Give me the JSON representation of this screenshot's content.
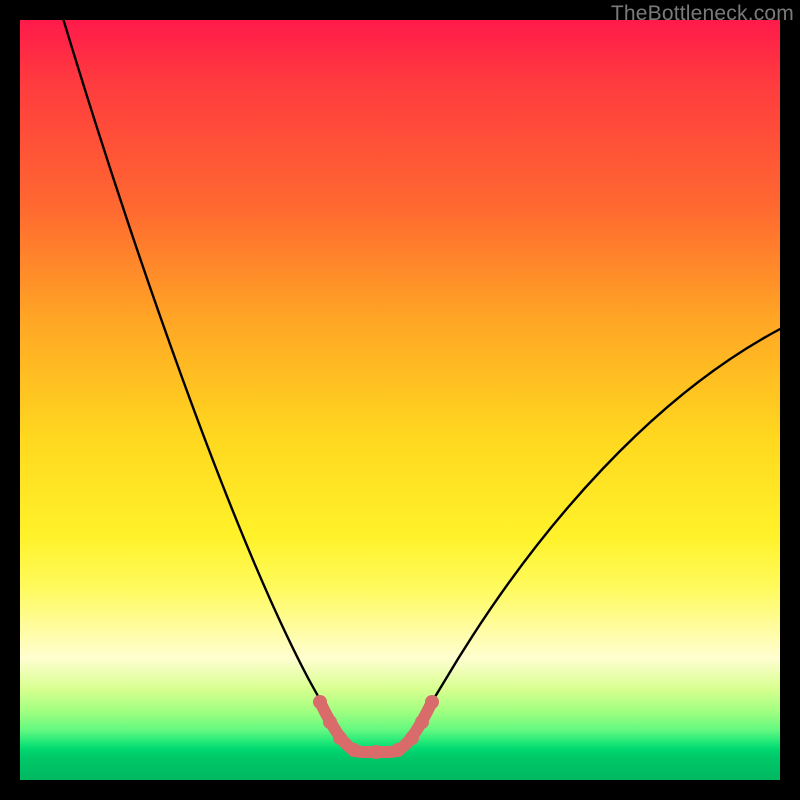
{
  "watermark": "TheBottleneck.com",
  "chart_data": {
    "type": "line",
    "title": "",
    "xlabel": "",
    "ylabel": "",
    "xlim": [
      0,
      100
    ],
    "ylim": [
      0,
      100
    ],
    "series": [
      {
        "name": "bottleneck-curve",
        "x": [
          5,
          10,
          15,
          20,
          25,
          30,
          35,
          38,
          40,
          42,
          44,
          46,
          48,
          50,
          55,
          60,
          65,
          70,
          80,
          90,
          100
        ],
        "y": [
          100,
          85,
          72,
          60,
          48,
          36,
          23,
          13,
          7,
          3,
          2,
          2,
          3,
          7,
          16,
          25,
          33,
          40,
          52,
          61,
          68
        ]
      }
    ],
    "annotations": {
      "optimal_zone_x": [
        40,
        50
      ],
      "optimal_zone_y": [
        2,
        7
      ]
    },
    "gradient_meaning": "red=high bottleneck, green=optimal"
  }
}
